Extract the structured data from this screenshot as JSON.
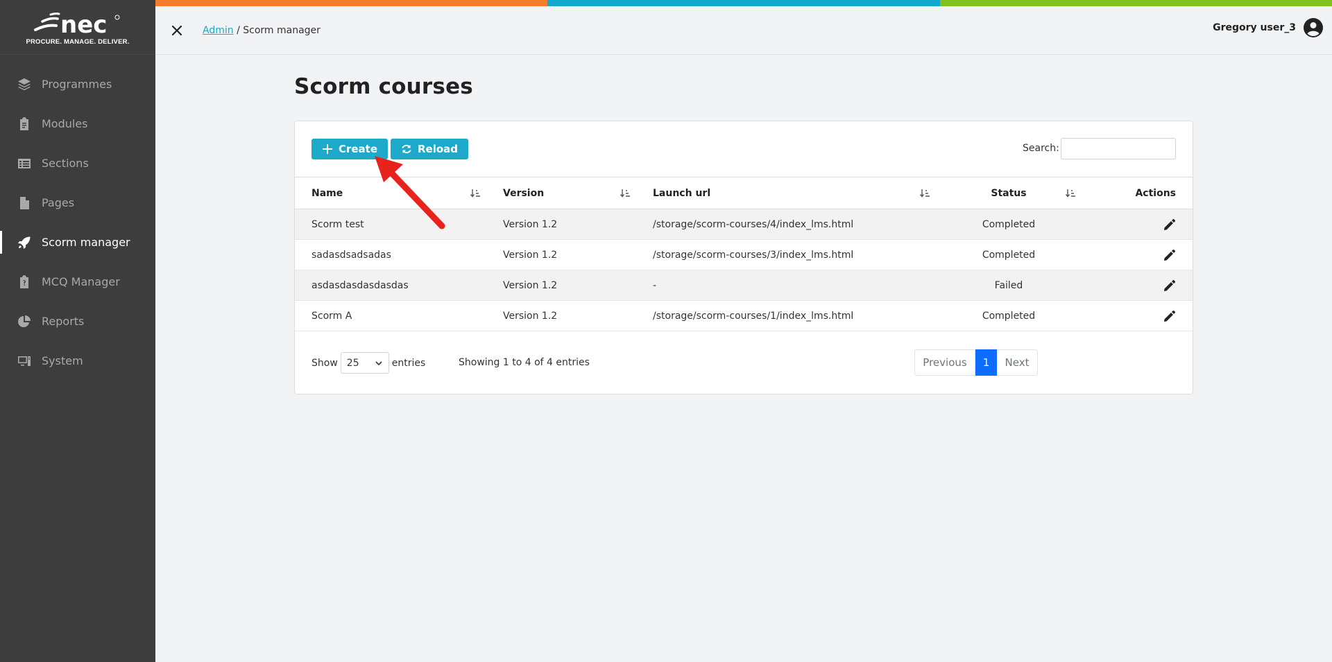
{
  "sidebar": {
    "logo_tagline": "PROCURE. MANAGE. DELIVER.",
    "items": [
      {
        "label": "Programmes",
        "icon": "layers-icon",
        "active": false
      },
      {
        "label": "Modules",
        "icon": "clipboard-icon",
        "active": false
      },
      {
        "label": "Sections",
        "icon": "list-icon",
        "active": false
      },
      {
        "label": "Pages",
        "icon": "file-icon",
        "active": false
      },
      {
        "label": "Scorm manager",
        "icon": "rocket-icon",
        "active": true
      },
      {
        "label": "MCQ Manager",
        "icon": "clipboard-question-icon",
        "active": false
      },
      {
        "label": "Reports",
        "icon": "pie-chart-icon",
        "active": false
      },
      {
        "label": "System",
        "icon": "computer-icon",
        "active": false
      }
    ]
  },
  "topbar_colors": [
    "#f47c2c",
    "#12a9cc",
    "#7fc31c"
  ],
  "header": {
    "breadcrumb_link": "Admin",
    "breadcrumb_separator": " / ",
    "breadcrumb_current": "Scorm manager",
    "user_name": "Gregory user_3"
  },
  "page": {
    "title": "Scorm courses"
  },
  "toolbar": {
    "create_label": "Create",
    "reload_label": "Reload",
    "search_label": "Search:",
    "search_value": ""
  },
  "table": {
    "headers": {
      "name": "Name",
      "version": "Version",
      "url": "Launch url",
      "status": "Status",
      "actions": "Actions"
    },
    "rows": [
      {
        "name": "Scorm test",
        "version": "Version 1.2",
        "url": "/storage/scorm-courses/4/index_lms.html",
        "status": "Completed"
      },
      {
        "name": "sadasdsadsadas",
        "version": "Version 1.2",
        "url": "/storage/scorm-courses/3/index_lms.html",
        "status": "Completed"
      },
      {
        "name": "asdasdasdasdasdas",
        "version": "Version 1.2",
        "url": "-",
        "status": "Failed"
      },
      {
        "name": "Scorm A",
        "version": "Version 1.2",
        "url": "/storage/scorm-courses/1/index_lms.html",
        "status": "Completed"
      }
    ]
  },
  "footer": {
    "show_label": "Show",
    "page_size": "25",
    "entries_label": "entries",
    "info": "Showing 1 to 4 of 4 entries",
    "prev_label": "Previous",
    "current_page": "1",
    "next_label": "Next"
  },
  "colors": {
    "sidebar_bg": "#3d3d3e",
    "accent": "#1da9c9",
    "pager_active": "#0d6efd",
    "annotation_arrow": "#e8231d"
  }
}
